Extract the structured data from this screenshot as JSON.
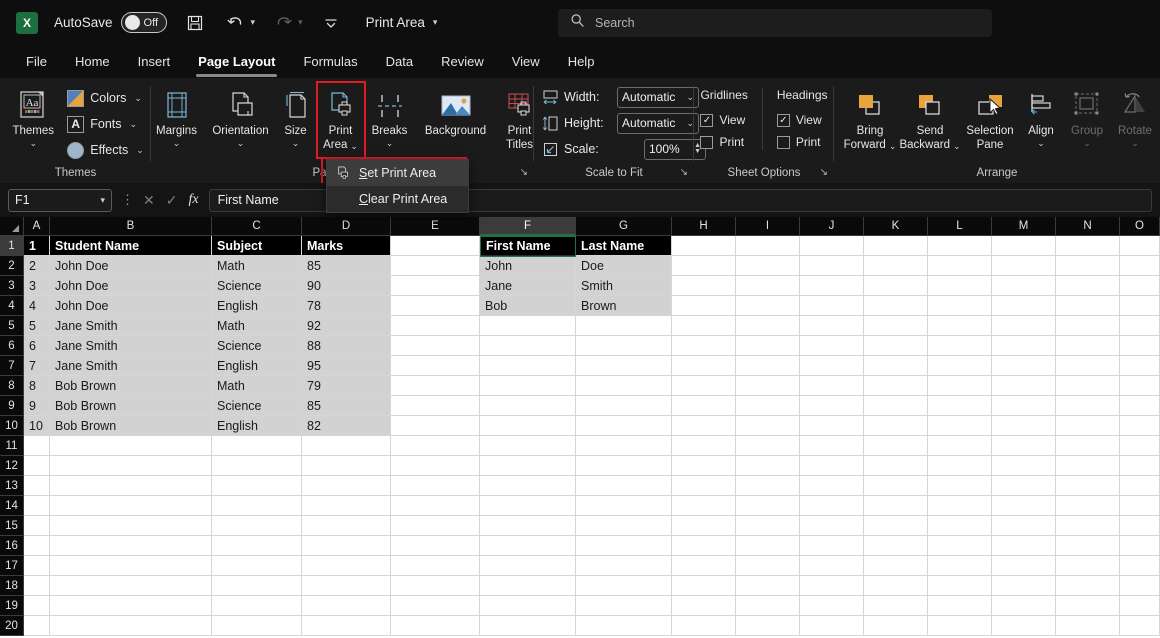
{
  "titlebar": {
    "logo_text": "X",
    "autosave_label": "AutoSave",
    "autosave_state": "Off",
    "save_icon": "save-icon",
    "undo_icon": "undo-icon",
    "redo_icon": "redo-icon",
    "customize_icon": "customize-quick-access-icon",
    "document_title": "Print Area",
    "title_chevron": "⌄"
  },
  "search": {
    "icon": "search-icon",
    "placeholder": "Search"
  },
  "tabs": [
    {
      "label": "File",
      "active": false
    },
    {
      "label": "Home",
      "active": false
    },
    {
      "label": "Insert",
      "active": false
    },
    {
      "label": "Page Layout",
      "active": true
    },
    {
      "label": "Formulas",
      "active": false
    },
    {
      "label": "Data",
      "active": false
    },
    {
      "label": "Review",
      "active": false
    },
    {
      "label": "View",
      "active": false
    },
    {
      "label": "Help",
      "active": false
    }
  ],
  "ribbon": {
    "themes_group": {
      "label": "Themes",
      "themes_button": {
        "label": "Themes",
        "chevron": "⌄",
        "icon": "themes-icon",
        "glyph": "Aa"
      },
      "small_items": [
        {
          "label": "Colors",
          "chevron": "⌄",
          "icon": "theme-colors-icon"
        },
        {
          "label": "Fonts",
          "chevron": "⌄",
          "icon": "theme-fonts-icon",
          "glyph": "A"
        },
        {
          "label": "Effects",
          "chevron": "⌄",
          "icon": "theme-effects-icon"
        }
      ]
    },
    "page_setup_group": {
      "label": "Page Setup",
      "label_visible_fragment": "Pag",
      "buttons": [
        {
          "label_line1": "Margins",
          "label_line2": "",
          "chevron": "⌄",
          "icon": "margins-icon"
        },
        {
          "label_line1": "Orientation",
          "label_line2": "",
          "chevron": "⌄",
          "icon": "orientation-icon"
        },
        {
          "label_line1": "Size",
          "label_line2": "",
          "chevron": "⌄",
          "icon": "size-icon"
        },
        {
          "label_line1": "Print",
          "label_line2": "Area",
          "chevron": "⌄",
          "icon": "print-area-icon",
          "highlighted": true
        },
        {
          "label_line1": "Breaks",
          "label_line2": "",
          "chevron": "⌄",
          "icon": "breaks-icon"
        },
        {
          "label_line1": "Background",
          "label_line2": "",
          "chevron": "",
          "icon": "background-icon"
        },
        {
          "label_line1": "Print",
          "label_line2": "Titles",
          "chevron": "",
          "icon": "print-titles-icon"
        }
      ],
      "dialog_launcher": "↘"
    },
    "scale_to_fit_group": {
      "label": "Scale to Fit",
      "rows": [
        {
          "label": "Width:",
          "value": "Automatic",
          "icon": "width-icon",
          "chevron": "⌄",
          "type": "combo"
        },
        {
          "label": "Height:",
          "value": "Automatic",
          "icon": "height-icon",
          "chevron": "⌄",
          "type": "combo"
        },
        {
          "label": "Scale:",
          "value": "100%",
          "icon": "scale-icon",
          "chevron": "",
          "type": "spin"
        }
      ],
      "dialog_launcher": "↘"
    },
    "sheet_options_group": {
      "label": "Sheet Options",
      "columns": [
        {
          "header": "Gridlines",
          "checks": [
            {
              "label": "View",
              "checked": true
            },
            {
              "label": "Print",
              "checked": false
            }
          ]
        },
        {
          "header": "Headings",
          "checks": [
            {
              "label": "View",
              "checked": true
            },
            {
              "label": "Print",
              "checked": false
            }
          ]
        }
      ],
      "dialog_launcher": "↘"
    },
    "arrange_group": {
      "label": "Arrange",
      "buttons": [
        {
          "label_line1": "Bring",
          "label_line2": "Forward",
          "chevron": "⌄",
          "icon": "bring-forward-icon",
          "disabled": false
        },
        {
          "label_line1": "Send",
          "label_line2": "Backward",
          "chevron": "⌄",
          "icon": "send-backward-icon",
          "disabled": false
        },
        {
          "label_line1": "Selection",
          "label_line2": "Pane",
          "chevron": "",
          "icon": "selection-pane-icon",
          "disabled": false
        },
        {
          "label_line1": "Align",
          "label_line2": "",
          "chevron": "⌄",
          "icon": "align-icon",
          "disabled": false
        },
        {
          "label_line1": "Group",
          "label_line2": "",
          "chevron": "⌄",
          "icon": "group-icon",
          "disabled": true
        },
        {
          "label_line1": "Rotate",
          "label_line2": "",
          "chevron": "⌄",
          "icon": "rotate-icon",
          "disabled": true
        }
      ]
    }
  },
  "print_area_menu": {
    "items": [
      {
        "label": "Set Print Area",
        "icon": "set-print-area-icon",
        "selected": true
      },
      {
        "label": "Clear Print Area",
        "icon": "",
        "selected": false
      }
    ]
  },
  "formula_bar": {
    "name_box_value": "F1",
    "name_box_chevron": "⌄",
    "cancel_icon": "cancel-icon",
    "enter_icon": "enter-icon",
    "function_icon": "insert-function-icon",
    "function_glyph": "fx",
    "formula_value": "First Name"
  },
  "grid": {
    "column_headers": [
      "A",
      "B",
      "C",
      "D",
      "E",
      "F",
      "G",
      "H",
      "I",
      "J",
      "K",
      "L",
      "M",
      "N",
      "O"
    ],
    "selected_column": "F",
    "row_headers": [
      "1",
      "2",
      "3",
      "4",
      "5",
      "6",
      "7",
      "8",
      "9",
      "10",
      "11",
      "12",
      "13",
      "14",
      "15",
      "16",
      "17",
      "18",
      "19",
      "20"
    ],
    "selected_row": "1",
    "active_cell": "F1",
    "table_left": {
      "header_row": [
        "1",
        "Student Name",
        "Subject",
        "Marks"
      ],
      "rows": [
        [
          "2",
          "John Doe",
          "Math",
          "85"
        ],
        [
          "3",
          "John Doe",
          "Science",
          "90"
        ],
        [
          "4",
          "John Doe",
          "English",
          "78"
        ],
        [
          "5",
          "Jane Smith",
          "Math",
          "92"
        ],
        [
          "6",
          "Jane Smith",
          "Science",
          "88"
        ],
        [
          "7",
          "Jane Smith",
          "English",
          "95"
        ],
        [
          "8",
          "Bob Brown",
          "Math",
          "79"
        ],
        [
          "9",
          "Bob Brown",
          "Science",
          "85"
        ],
        [
          "10",
          "Bob Brown",
          "English",
          "82"
        ]
      ]
    },
    "table_right": {
      "header_row": [
        "First Name",
        "Last Name"
      ],
      "rows": [
        [
          "John",
          "Doe"
        ],
        [
          "Jane",
          "Smith"
        ],
        [
          "Bob",
          "Brown"
        ]
      ]
    }
  },
  "colors": {
    "accent_green": "#217346",
    "highlight_red": "#e01b24",
    "ribbon_bg": "#1b1b1b",
    "grid_header_bg": "#0a0a0a",
    "data_cell_bg": "#d2d2d2",
    "header_cell_bg": "#000000",
    "arrange_orange": "#e8a33d"
  }
}
